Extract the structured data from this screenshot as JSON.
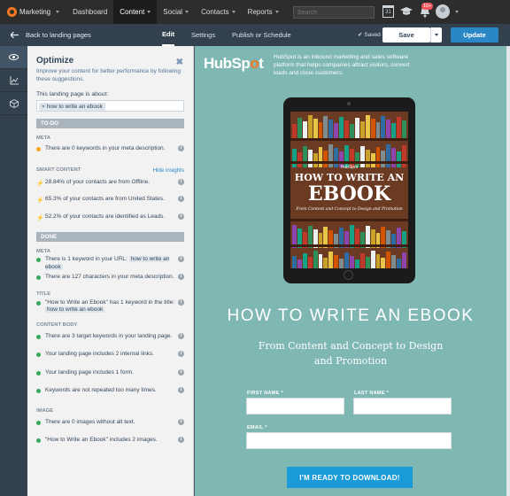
{
  "topnav": {
    "brand": "Marketing",
    "items": [
      "Dashboard",
      "Content",
      "Social",
      "Contacts",
      "Reports"
    ],
    "search_placeholder": "Search",
    "calendar_day": "31",
    "notif_count": "10+"
  },
  "subnav": {
    "back_label": "Back to landing pages",
    "tabs": [
      "Edit",
      "Settings",
      "Publish or Schedule"
    ],
    "saved": "Saved",
    "save_label": "Save",
    "update_label": "Update"
  },
  "optimize": {
    "title": "Optimize",
    "description": "Improve your content for better performance by following these suggestions.",
    "about_label": "This landing page is about:",
    "keyword": "how to write an ebook",
    "todo_label": "TO-DO",
    "todo": {
      "meta_label": "META",
      "meta_items": [
        "There are 0 keywords in your meta description."
      ],
      "smart_label": "SMART CONTENT",
      "hide_insights": "Hide insights",
      "smart_items": [
        "28.84% of your contacts are from Offline.",
        "65.3% of your contacts are from United States.",
        "52.2% of your contacts are identified as Leads."
      ]
    },
    "done_label": "DONE",
    "done": {
      "meta_label": "META",
      "meta_item1_prefix": "There is 1 keyword in your URL:",
      "meta_item1_kw": "how to write an ebook",
      "meta_item2": "There are 127 characters in your meta description.",
      "title_label": "TITLE",
      "title_item_prefix": "\"How to Write an Ebook\" has 1 keyword in the title:",
      "title_item_kw": "how to write an ebook",
      "body_label": "CONTENT BODY",
      "body_items": [
        "There are 3 target keywords in your landing page.",
        "Your landing page includes 2 internal links.",
        "Your landing page includes 1 form.",
        "Keywords are not repeated too many times."
      ],
      "image_label": "IMAGE",
      "image_items": [
        "There are 0 images without alt text.",
        "\"How to Write an Ebook\" includes 2 images."
      ]
    }
  },
  "preview": {
    "logo_text_a": "HubSp",
    "logo_text_o": "o",
    "logo_text_b": "t",
    "tagline": "HubSpot is an inbound marketing and sales software platform that helps companies attract visitors, convert leads and close customers.",
    "cover_brand": "HubSpot",
    "cover_line1": "HOW TO WRITE AN",
    "cover_line2": "EBOOK",
    "cover_sub": "From Content and Concept to Design and Promotion",
    "headline": "HOW TO WRITE AN EBOOK",
    "subheadline": "From Content and Concept to Design and Promotion",
    "first_name_label": "FIRST NAME *",
    "last_name_label": "LAST NAME *",
    "email_label": "EMAIL *",
    "cta_label": "I'M READY TO DOWNLOAD!"
  },
  "colors": {
    "topnav": "#2d2d2d",
    "subnav": "#33414e",
    "accent_blue": "#2b86c5",
    "preview_bg": "#7fb7b2",
    "cta": "#1a9ad6",
    "done_dot": "#39a85b",
    "todo_dot": "#f5a623"
  }
}
